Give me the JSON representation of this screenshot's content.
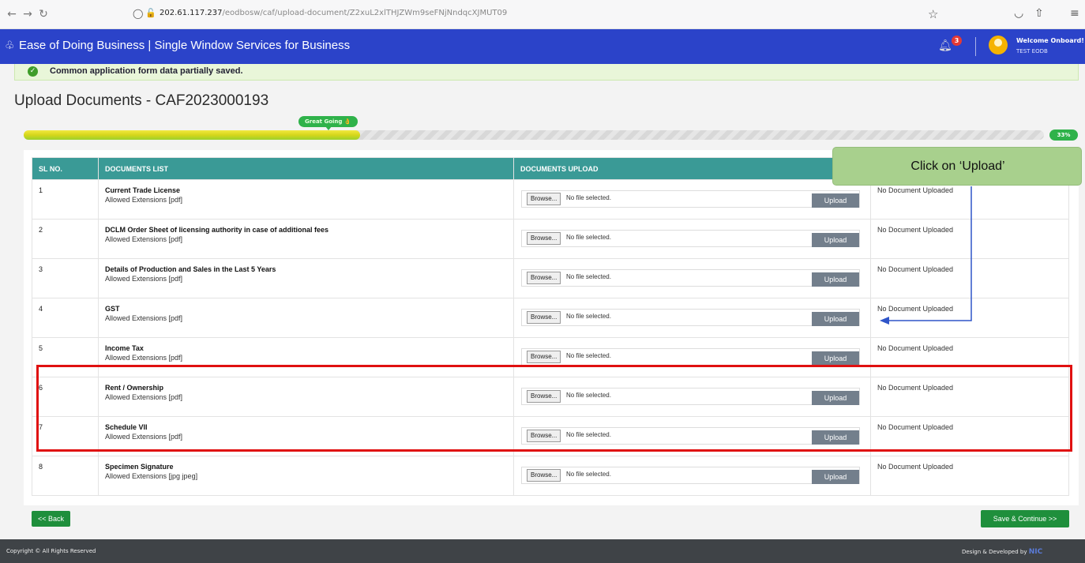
{
  "browser": {
    "url_host": "202.61.117.237",
    "url_path": "/eodbosw/caf/upload-document/Z2xuL2xlTHJZWm9seFNjNndqcXJMUT09"
  },
  "header": {
    "title": "Ease of Doing Business | Single Window Services for Business",
    "notification_count": "3",
    "welcome": "Welcome Onboard!",
    "user": "TEST EODB"
  },
  "alert": {
    "text": "Common application form data partially saved."
  },
  "page": {
    "title": "Upload Documents - CAF2023000193"
  },
  "progress": {
    "label": "Great Going 👌",
    "percent_text": "33%",
    "fraction": 0.33
  },
  "table": {
    "headers": [
      "SL NO.",
      "DOCUMENTS LIST",
      "DOCUMENTS UPLOAD",
      ""
    ],
    "browse_label": "Browse...",
    "file_status": "No file selected.",
    "upload_label": "Upload",
    "rows": [
      {
        "sl": "1",
        "name": "Current Trade License",
        "ext": "Allowed Extensions [pdf]",
        "status": "No Document Uploaded"
      },
      {
        "sl": "2",
        "name": "DCLM Order Sheet of licensing authority in case of additional fees",
        "ext": "Allowed Extensions [pdf]",
        "status": "No Document Uploaded"
      },
      {
        "sl": "3",
        "name": "Details of Production and Sales in the Last 5 Years",
        "ext": "Allowed Extensions [pdf]",
        "status": "No Document Uploaded"
      },
      {
        "sl": "4",
        "name": "GST",
        "ext": "Allowed Extensions [pdf]",
        "status": "No Document Uploaded"
      },
      {
        "sl": "5",
        "name": "Income Tax",
        "ext": "Allowed Extensions [pdf]",
        "status": "No Document Uploaded"
      },
      {
        "sl": "6",
        "name": "Rent / Ownership",
        "ext": "Allowed Extensions [pdf]",
        "status": "No Document Uploaded"
      },
      {
        "sl": "7",
        "name": "Schedule VII",
        "ext": "Allowed Extensions [pdf]",
        "status": "No Document Uploaded"
      },
      {
        "sl": "8",
        "name": "Specimen Signature",
        "ext": "Allowed Extensions [jpg jpeg]",
        "status": "No Document Uploaded"
      }
    ]
  },
  "buttons": {
    "back": "<< Back",
    "save": "Save & Continue >>"
  },
  "footer": {
    "left": "Copyright © All Rights Reserved",
    "right": "Design & Developed by",
    "logo": "NIC"
  },
  "annotation": {
    "callout": "Click on ‘Upload’"
  },
  "colors": {
    "header": "#2b43c9",
    "teal": "#3a9a96",
    "green": "#1f8f3c",
    "highlight": "#e01010",
    "callout": "#a8d08d"
  }
}
